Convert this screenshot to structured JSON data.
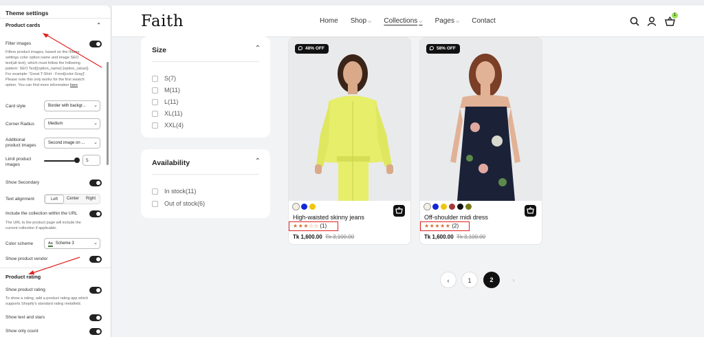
{
  "panel": {
    "title": "Theme settings",
    "product_cards_heading": "Product cards",
    "filter_images_label": "Filter images",
    "filter_help_1": "Filters product images, based on the theme",
    "filter_help_2": "settings color option name and image SEO",
    "filter_help_3": "text(alt text), which must follow the following",
    "filter_help_4": "pattern: SEO Text[{option_name}:{option_value}].",
    "filter_help_5": "For example: 'Great T-Shirt - Front[color:Gray]'.",
    "filter_help_6": "Please note this only works for the first swatch",
    "filter_help_7": "option. You can find more information",
    "filter_help_link": "here",
    "card_style_label": "Card style",
    "card_style_value": "Border with backgr...",
    "corner_radius_label": "Corner Radius",
    "corner_radius_value": "Medium",
    "additional_images_label_1": "Additional",
    "additional_images_label_2": "product images",
    "additional_images_value": "Second image on ...",
    "limit_images_label_1": "Limit product",
    "limit_images_label_2": "images",
    "limit_images_value": "5",
    "show_secondary_label": "Show Secondary",
    "text_alignment_label": "Text alignment",
    "align_left": "Left",
    "align_center": "Center",
    "align_right": "Right",
    "include_collection_label": "Include the collection within the URL",
    "include_help_1": "The URL to the product page will include the",
    "include_help_2": "current collection if applicable.",
    "color_scheme_label": "Color scheme",
    "color_scheme_value": "Scheme 3",
    "show_vendor_label": "Show product vendor",
    "product_rating_heading": "Product rating",
    "show_rating_label": "Show product rating",
    "rating_help_1": "To show a rating, add a product rating app which",
    "rating_help_2": "supports Shopify's standard rating metafield.",
    "show_text_stars_label": "Show text and stars",
    "show_only_count_label": "Show only count"
  },
  "header": {
    "logo": "Faith",
    "nav": [
      {
        "label": "Home",
        "dropdown": false
      },
      {
        "label": "Shop",
        "dropdown": true
      },
      {
        "label": "Collections",
        "dropdown": true
      },
      {
        "label": "Pages",
        "dropdown": true
      },
      {
        "label": "Contact",
        "dropdown": false
      }
    ],
    "cart_count": "1"
  },
  "filters": {
    "size": {
      "title": "Size",
      "options": [
        "S(7)",
        "M(11)",
        "L(11)",
        "XL(11)",
        "XXL(4)"
      ]
    },
    "availability": {
      "title": "Availability",
      "options": [
        "In stock(11)",
        "Out of stock(6)"
      ]
    }
  },
  "products": [
    {
      "badge": "48% OFF",
      "name": "High-waisted skinny jeans",
      "stars": "★★★",
      "empty_stars": "☆☆",
      "rating_count": "(1)",
      "rating_value": 3,
      "price": "Tk 1,600.00",
      "compare_price": "Tk 3,100.00",
      "swatches": [
        "#f3efe2",
        "#1426d6",
        "#f1c40f"
      ]
    },
    {
      "badge": "58% OFF",
      "name": "Off-shoulder midi dress",
      "stars": "★★★★★",
      "empty_stars": "",
      "rating_count": "(2)",
      "rating_value": 5,
      "price": "Tk 1,600.00",
      "compare_price": "Tk 3,100.00",
      "swatches": [
        "#f3efe2",
        "#1426d6",
        "#f1c40f",
        "#a33a3a",
        "#111111",
        "#7a7a1a"
      ]
    }
  ],
  "pagination": {
    "prev": "‹",
    "pages": [
      "1",
      "2"
    ],
    "current": "2",
    "next": "›"
  },
  "colors": {
    "highlight": "#e02020",
    "star": "#d0723a",
    "cart_badge": "#9be15d"
  }
}
